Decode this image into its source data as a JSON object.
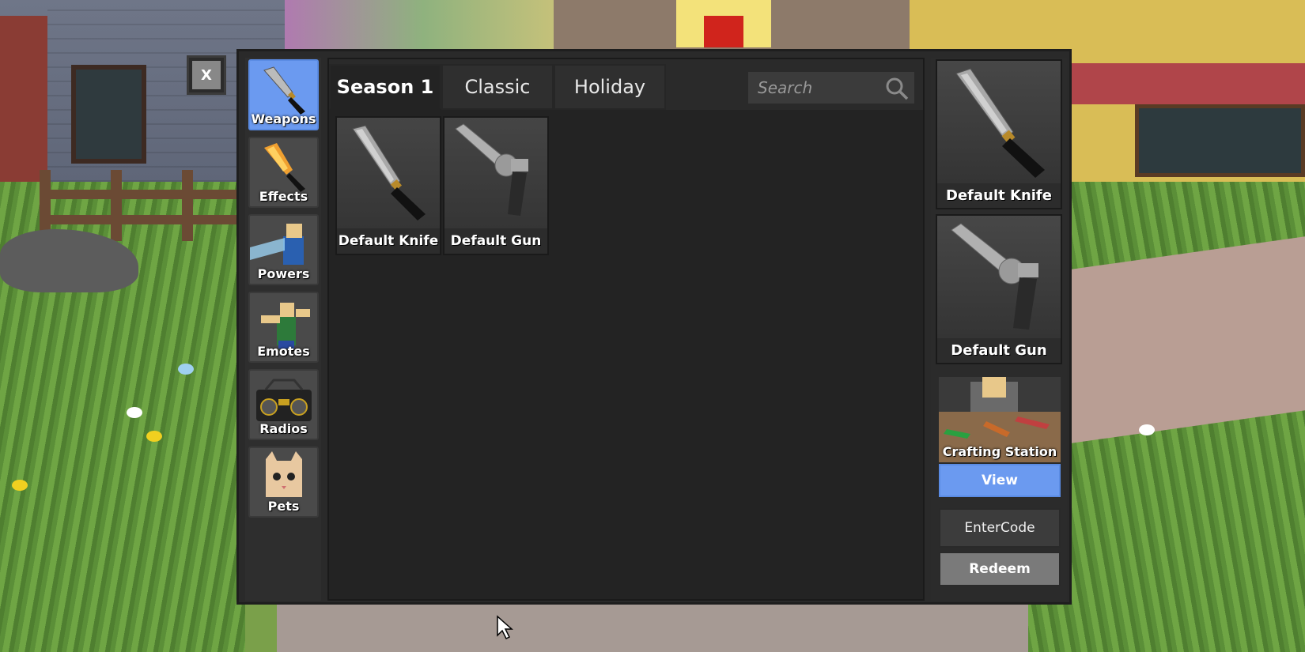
{
  "close_button": {
    "label": "X"
  },
  "categories": [
    {
      "label": "Weapons",
      "icon": "knife-icon",
      "active": true
    },
    {
      "label": "Effects",
      "icon": "flaming-knife-icon",
      "active": false
    },
    {
      "label": "Powers",
      "icon": "powers-icon",
      "active": false
    },
    {
      "label": "Emotes",
      "icon": "emote-icon",
      "active": false
    },
    {
      "label": "Radios",
      "icon": "radio-icon",
      "active": false
    },
    {
      "label": "Pets",
      "icon": "pet-cat-icon",
      "active": false
    }
  ],
  "tabs": [
    {
      "label": "Season 1",
      "active": true
    },
    {
      "label": "Classic",
      "active": false
    },
    {
      "label": "Holiday",
      "active": false
    }
  ],
  "search": {
    "placeholder": "Search",
    "icon": "search-icon"
  },
  "inventory_items": [
    {
      "label": "Default Knife",
      "icon": "knife-icon"
    },
    {
      "label": "Default Gun",
      "icon": "revolver-icon"
    }
  ],
  "equipped": [
    {
      "label": "Default Knife",
      "icon": "knife-icon"
    },
    {
      "label": "Default Gun",
      "icon": "revolver-icon"
    }
  ],
  "crafting": {
    "label": "Crafting Station",
    "view_label": "View"
  },
  "code": {
    "enter_label": "EnterCode",
    "redeem_label": "Redeem"
  },
  "colors": {
    "accent": "#6b9af0",
    "panel": "#232323",
    "frame": "#2a2a2a"
  }
}
